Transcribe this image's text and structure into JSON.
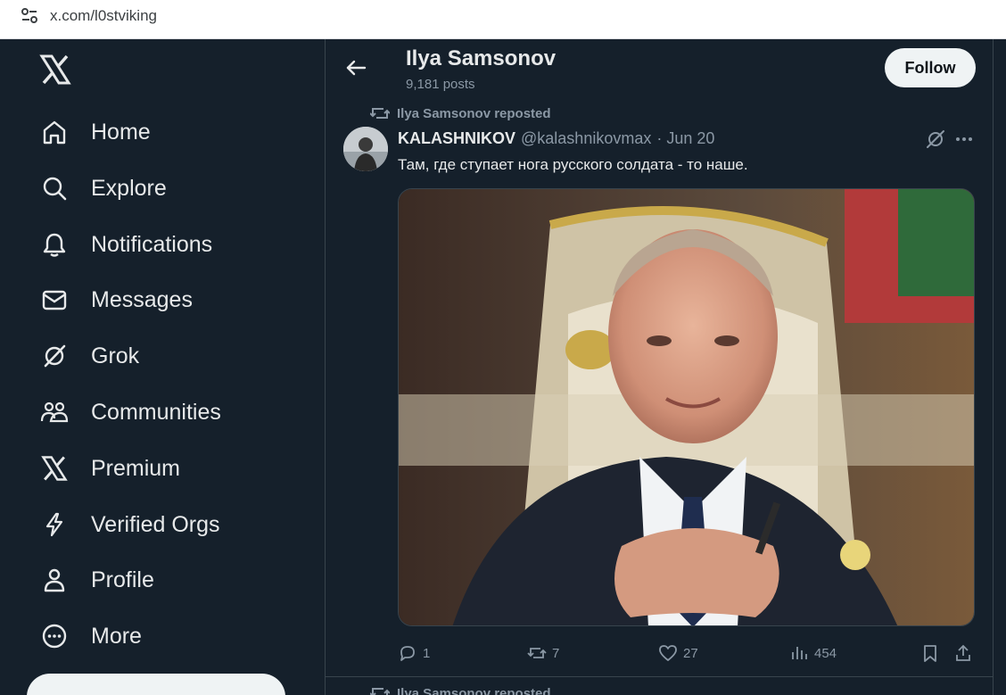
{
  "browser": {
    "url": "x.com/l0stviking"
  },
  "sidebar": {
    "logo": "x-logo-icon",
    "items": [
      {
        "label": "Home",
        "icon": "home-icon"
      },
      {
        "label": "Explore",
        "icon": "search-icon"
      },
      {
        "label": "Notifications",
        "icon": "bell-icon"
      },
      {
        "label": "Messages",
        "icon": "envelope-icon"
      },
      {
        "label": "Grok",
        "icon": "grok-icon"
      },
      {
        "label": "Communities",
        "icon": "people-icon"
      },
      {
        "label": "Premium",
        "icon": "x-logo-icon"
      },
      {
        "label": "Verified Orgs",
        "icon": "lightning-icon"
      },
      {
        "label": "Profile",
        "icon": "person-icon"
      },
      {
        "label": "More",
        "icon": "more-circle-icon"
      }
    ]
  },
  "header": {
    "name": "Ilya Samsonov",
    "posts": "9,181 posts",
    "follow_label": "Follow"
  },
  "tweet": {
    "repost_text": "Ilya Samsonov reposted",
    "author_name": "KALASHNIKOV",
    "author_handle": "@kalashnikovmax",
    "date": "· Jun 20",
    "text": "Там, где ступает нога русского солдата - то наше.",
    "replies": "1",
    "reposts": "7",
    "likes": "27",
    "views": "454"
  },
  "next_tweet": {
    "repost_text": "Ilya Samsonov reposted"
  },
  "colors": {
    "background": "#15202b",
    "text": "#e7e9ea",
    "muted": "#8b98a5",
    "border": "#38444d"
  }
}
